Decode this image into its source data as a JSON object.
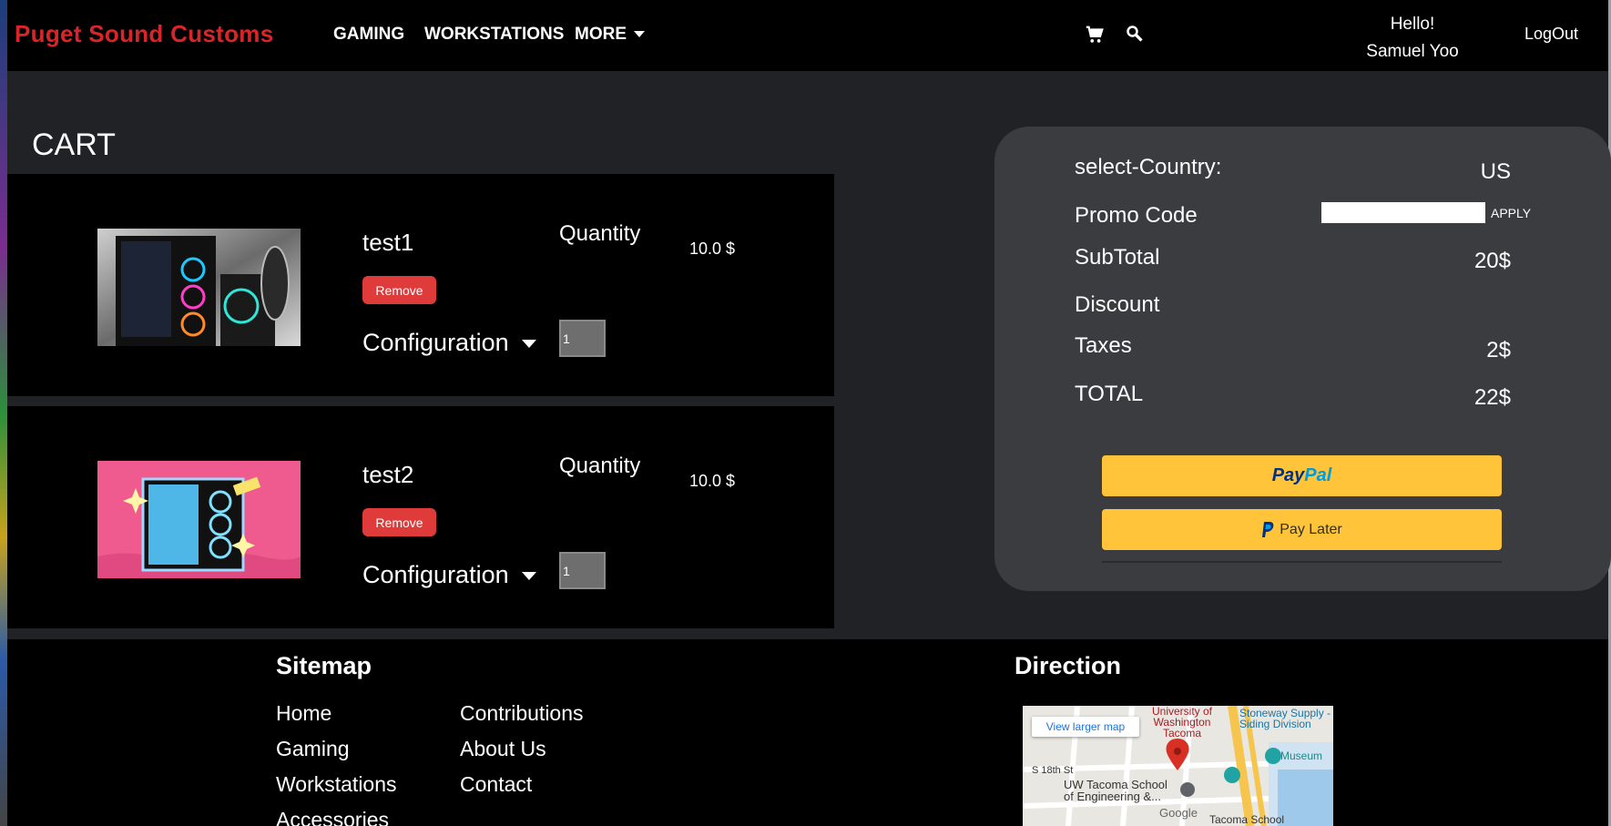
{
  "header": {
    "brand": "Puget Sound Customs",
    "nav": [
      "GAMING",
      "WORKSTATIONS",
      "MORE"
    ],
    "greeting": "Hello!",
    "user_name": "Samuel Yoo",
    "logout": "LogOut",
    "icons": [
      "cart-icon",
      "search-icon"
    ]
  },
  "cart": {
    "title": "CART",
    "items": [
      {
        "name": "test1",
        "remove_label": "Remove",
        "config_label": "Configuration",
        "qty_label": "Quantity",
        "price": "10.0 $",
        "quantity": "1"
      },
      {
        "name": "test2",
        "remove_label": "Remove",
        "config_label": "Configuration",
        "qty_label": "Quantity",
        "price": "10.0 $",
        "quantity": "1"
      }
    ]
  },
  "summary": {
    "country_label": "select-Country:",
    "country_value": "US",
    "promo_label": "Promo Code",
    "promo_value": "",
    "apply_label": "APPLY",
    "subtotal_label": "SubTotal",
    "subtotal_value": "20$",
    "discount_label": "Discount",
    "discount_value": "",
    "taxes_label": "Taxes",
    "taxes_value": "2$",
    "total_label": "TOTAL",
    "total_value": "22$",
    "paypal_pay": "Pay",
    "paypal_pal": "Pal",
    "pay_later_label": "Pay Later",
    "paypal_color": "#ffc439"
  },
  "footer": {
    "sitemap_title": "Sitemap",
    "sitemap_col1": [
      "Home",
      "Gaming",
      "Workstations",
      "Accessories"
    ],
    "sitemap_col2": [
      "Contributions",
      "About Us",
      "Contact"
    ],
    "direction_title": "Direction",
    "map": {
      "button": "View larger map",
      "labels": [
        "University of Washington Tacoma",
        "Stoneway Supply - Siding Division",
        "Museum",
        "S 18th St",
        "UW Tacoma School of Engineering &...",
        "Google",
        "Tacoma School"
      ]
    }
  },
  "colors": {
    "brand": "#d9252a",
    "remove": "#e03b3b",
    "panel": "#3b3c3f"
  }
}
